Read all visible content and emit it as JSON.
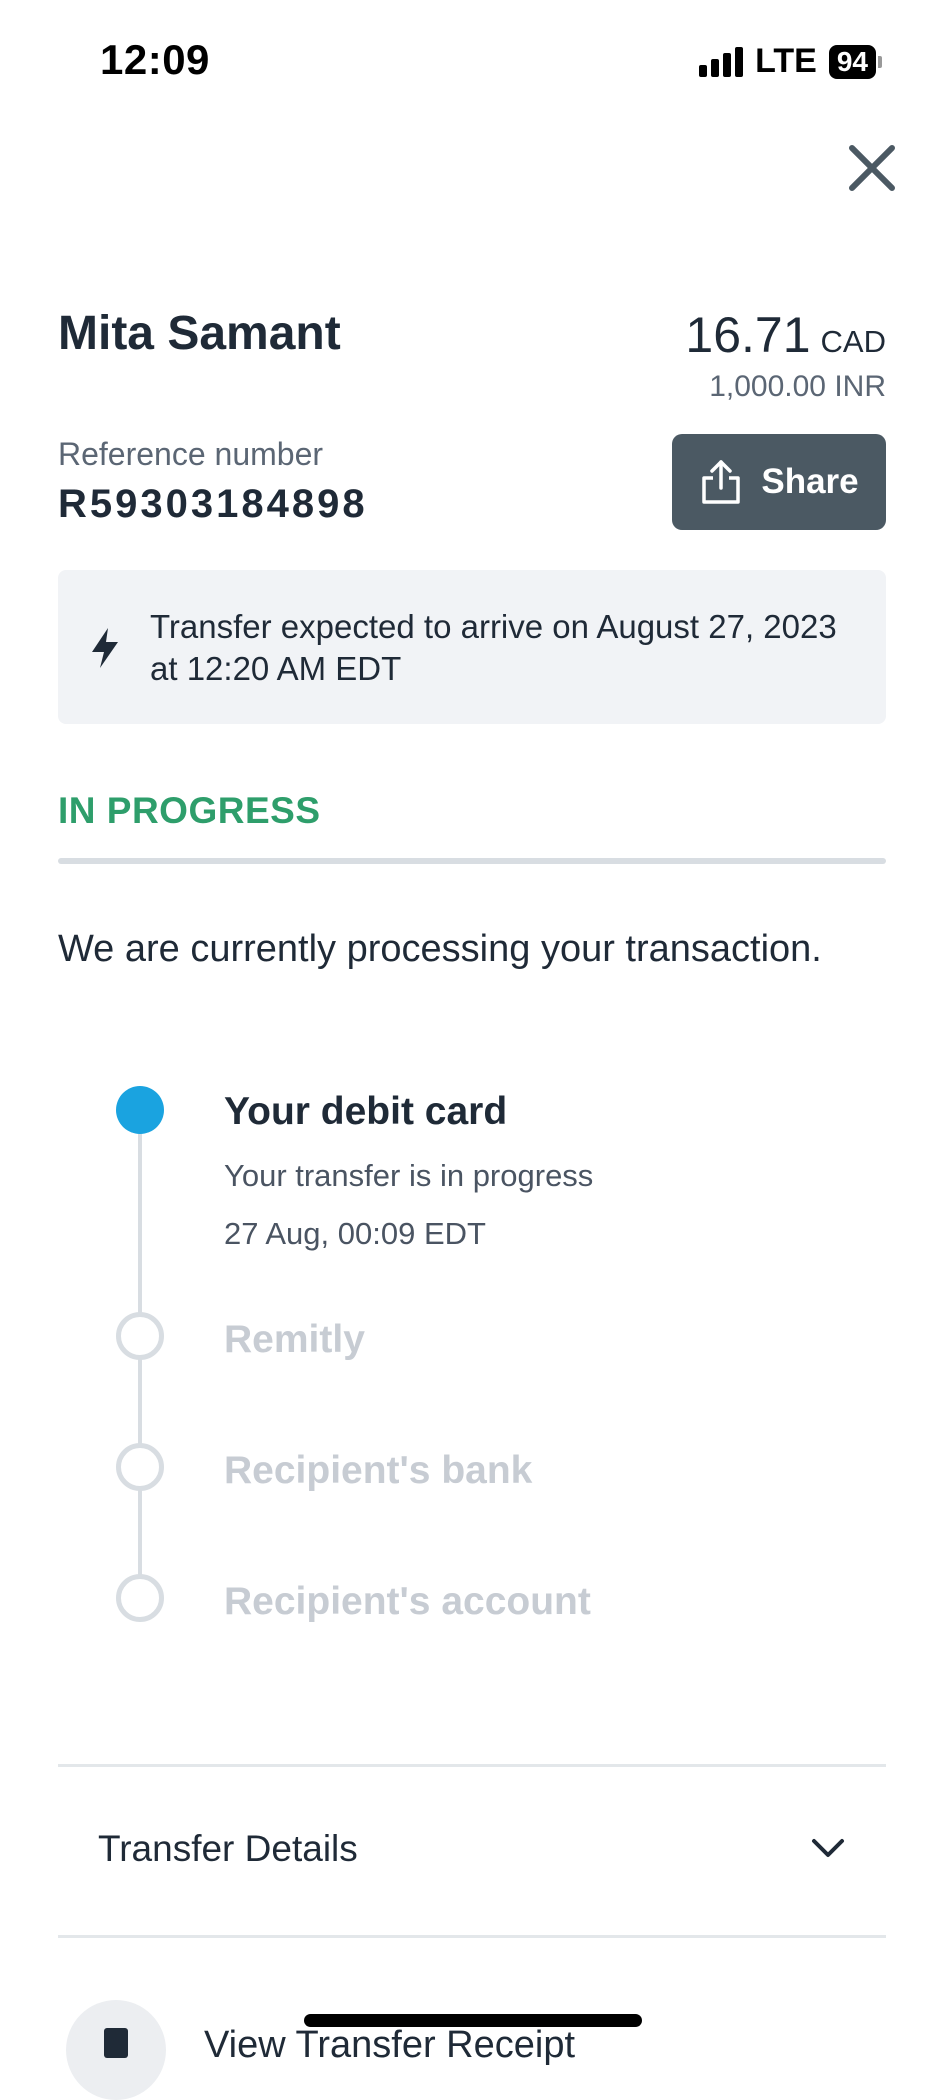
{
  "status_bar": {
    "time": "12:09",
    "network": "LTE",
    "battery": "94"
  },
  "header": {
    "recipient_name": "Mita Samant",
    "amount": "16.71",
    "currency": "CAD",
    "converted_amount": "1,000.00 INR",
    "reference_label": "Reference number",
    "reference_number": "R59303184898",
    "share_label": "Share"
  },
  "banner": {
    "text": "Transfer expected to arrive on August 27, 2023 at 12:20 AM EDT"
  },
  "status": {
    "label": "IN PROGRESS",
    "label_color": "#2e9e6b",
    "message": "We are currently processing your transaction."
  },
  "timeline": {
    "steps": [
      {
        "title": "Your debit card",
        "subtitle": "Your transfer is in progress",
        "time": "27 Aug, 00:09 EDT",
        "active": true
      },
      {
        "title": "Remitly",
        "active": false
      },
      {
        "title": "Recipient's bank",
        "active": false
      },
      {
        "title": "Recipient's account",
        "active": false
      }
    ],
    "active_color": "#1aa3e0"
  },
  "details": {
    "label": "Transfer Details"
  },
  "receipt": {
    "label": "View Transfer Receipt"
  },
  "icons": {
    "close": "close-icon",
    "share": "share-icon",
    "bolt": "lightning-icon",
    "chevron": "chevron-down-icon",
    "receipt": "receipt-icon"
  }
}
